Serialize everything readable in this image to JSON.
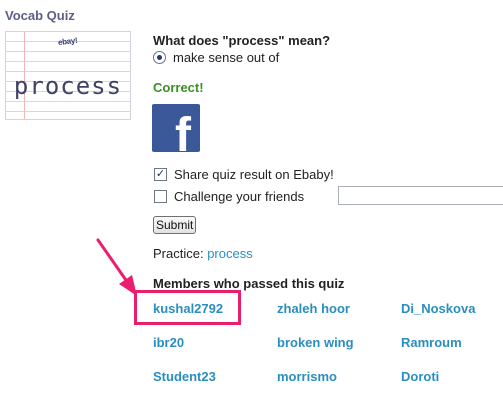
{
  "app": {
    "title": "Vocab Quiz"
  },
  "flashcard": {
    "word": "process",
    "mini_text": "ebay!"
  },
  "question": {
    "text": "What does \"process\" mean?",
    "answer": "make sense out of",
    "result": "Correct!"
  },
  "share": {
    "facebook_icon": "facebook-icon",
    "share_label": "Share quiz result on Ebaby!",
    "share_checked": true,
    "challenge_label": "Challenge your friends",
    "challenge_checked": false,
    "friend_input_value": ""
  },
  "submit_label": "Submit",
  "practice": {
    "label": "Practice:",
    "link": "process"
  },
  "members": {
    "title": "Members who passed this quiz",
    "rows": [
      [
        "kushal2792",
        "zhaleh hoor",
        "Di_Noskova"
      ],
      [
        "ibr20",
        "broken wing",
        "Ramroum"
      ],
      [
        "Student23",
        "morrismo",
        "Doroti"
      ]
    ]
  },
  "colors": {
    "accent_link": "#2a8ebf",
    "correct": "#3b8f27",
    "highlight": "#ea1e6e",
    "facebook": "#3b5998",
    "title": "#5b5f86"
  }
}
